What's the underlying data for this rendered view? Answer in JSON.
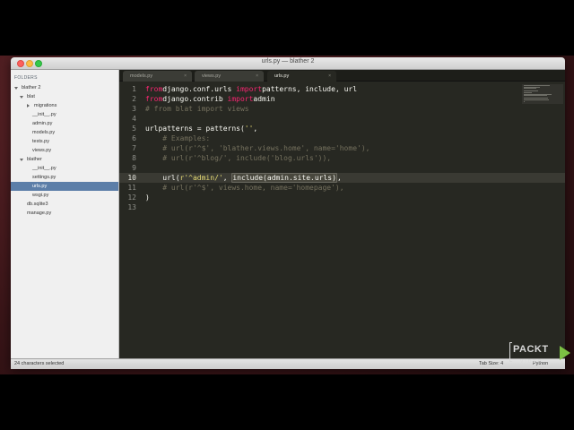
{
  "window": {
    "title": "urls.py — blather 2"
  },
  "sidebar": {
    "header": "FOLDERS",
    "items": [
      {
        "label": "blather 2",
        "depth": 0,
        "kind": "folder-open"
      },
      {
        "label": "blat",
        "depth": 1,
        "kind": "folder-open"
      },
      {
        "label": "migrations",
        "depth": 2,
        "kind": "folder-closed"
      },
      {
        "label": "__init__.py",
        "depth": 3,
        "kind": "file"
      },
      {
        "label": "admin.py",
        "depth": 3,
        "kind": "file"
      },
      {
        "label": "models.py",
        "depth": 3,
        "kind": "file"
      },
      {
        "label": "tests.py",
        "depth": 3,
        "kind": "file"
      },
      {
        "label": "views.py",
        "depth": 3,
        "kind": "file"
      },
      {
        "label": "blather",
        "depth": 1,
        "kind": "folder-open"
      },
      {
        "label": "__init__.py",
        "depth": 3,
        "kind": "file"
      },
      {
        "label": "settings.py",
        "depth": 3,
        "kind": "file"
      },
      {
        "label": "urls.py",
        "depth": 3,
        "kind": "file",
        "selected": true
      },
      {
        "label": "wsgi.py",
        "depth": 3,
        "kind": "file"
      },
      {
        "label": "db.sqlite3",
        "depth": 2,
        "kind": "file"
      },
      {
        "label": "manage.py",
        "depth": 2,
        "kind": "file"
      }
    ]
  },
  "tabs": [
    {
      "label": "models.py",
      "close": "×",
      "active": false
    },
    {
      "label": "views.py",
      "close": "×",
      "active": false
    },
    {
      "label": "urls.py",
      "close": "×",
      "active": true
    }
  ],
  "editor": {
    "current_line": 10,
    "lines": [
      {
        "n": "1",
        "tokens": [
          [
            "kw",
            "from"
          ],
          [
            "",
            "django.conf.urls "
          ],
          [
            "kw",
            "import"
          ],
          [
            "",
            "patterns, include, url"
          ]
        ]
      },
      {
        "n": "2",
        "tokens": [
          [
            "kw",
            "from"
          ],
          [
            "",
            "django.contrib "
          ],
          [
            "kw",
            "import"
          ],
          [
            "",
            "admin"
          ]
        ]
      },
      {
        "n": "3",
        "tokens": [
          [
            "cm",
            "# from blat import views"
          ]
        ]
      },
      {
        "n": "4",
        "tokens": []
      },
      {
        "n": "5",
        "tokens": [
          [
            "",
            "urlpatterns = patterns("
          ],
          [
            "str",
            "''"
          ],
          [
            "",
            ","
          ]
        ]
      },
      {
        "n": "6",
        "tokens": [
          [
            "cm",
            "    # Examples:"
          ]
        ]
      },
      {
        "n": "7",
        "tokens": [
          [
            "cm",
            "    # url(r'^$', 'blather.views.home', name='home'),"
          ]
        ]
      },
      {
        "n": "8",
        "tokens": [
          [
            "cm",
            "    # url(r'^blog/', include('blog.urls')),"
          ]
        ]
      },
      {
        "n": "9",
        "tokens": []
      },
      {
        "n": "10",
        "tokens": [
          [
            "",
            "    url("
          ],
          [
            "str",
            "r'^admin/'"
          ],
          [
            "",
            ", "
          ],
          [
            "sel",
            "include(admin.site.urls)"
          ],
          [
            "",
            ","
          ]
        ]
      },
      {
        "n": "11",
        "tokens": [
          [
            "cm",
            "    # url(r'^$', views.home, name='homepage'),"
          ]
        ]
      },
      {
        "n": "12",
        "tokens": [
          [
            "",
            ")"
          ]
        ]
      },
      {
        "n": "13",
        "tokens": []
      }
    ]
  },
  "statusbar": {
    "selection": "24 characters selected",
    "tab_size": "Tab Size: 4",
    "syntax": "Python"
  },
  "brand": {
    "name": "PACKT",
    "sub": "VIDEO",
    "icon": "play-icon",
    "icon_color": "#7cc043"
  },
  "colors": {
    "keyword": "#f92672",
    "string": "#e6db74",
    "comment": "#75715e",
    "selection_sidebar": "#5c7ea8"
  }
}
